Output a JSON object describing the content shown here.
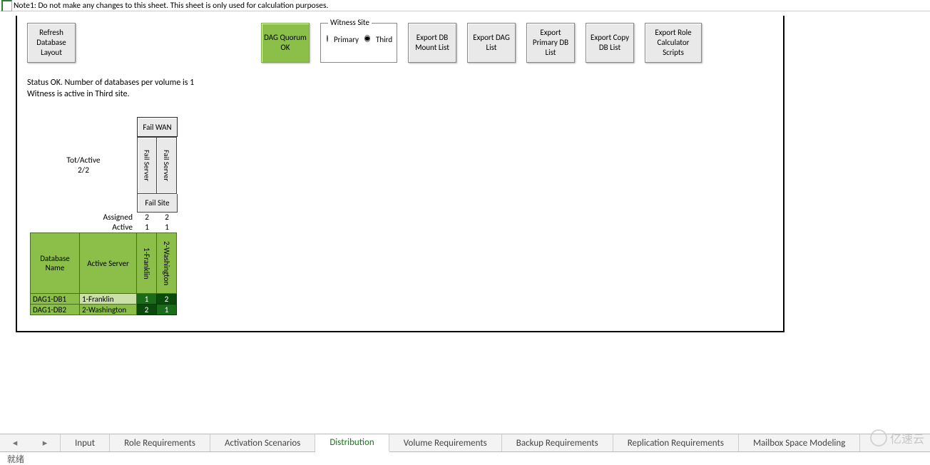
{
  "note": "Note1: Do not make any changes to this sheet.  This sheet is only used for calculation purposes.",
  "toolbar": {
    "refresh": "Refresh Database Layout",
    "dag_quorum": "DAG Quorum OK",
    "witness_legend": "Witness Site",
    "witness_primary": "Primary",
    "witness_third": "Third",
    "witness_selected": "Third",
    "export_mount": "Export DB Mount List",
    "export_dag": "Export DAG List",
    "export_primary": "Export Primary DB List",
    "export_copy": "Export Copy DB List",
    "export_role": "Export Role Calculator Scripts"
  },
  "status": {
    "line1": "Status OK.  Number of databases per volume is 1",
    "line2": "Witness is active in Third site."
  },
  "fail": {
    "wan": "Fail WAN",
    "server": "Fail Server",
    "site": "Fail Site",
    "tot_label": "Tot/Active",
    "tot_value": "2/2",
    "assigned_label": "Assigned",
    "active_label": "Active",
    "assigned": [
      "2",
      "2"
    ],
    "active": [
      "1",
      "1"
    ]
  },
  "headers": {
    "db_name": "Database Name",
    "active_server": "Active Server",
    "cols": [
      "1-Franklin",
      "2-Washington"
    ]
  },
  "rows": [
    {
      "db": "DAG1-DB1",
      "server": "1-Franklin",
      "v": [
        "1",
        "2"
      ],
      "cls": [
        "g1",
        "g2"
      ]
    },
    {
      "db": "DAG1-DB2",
      "server": "2-Washington",
      "v": [
        "2",
        "1"
      ],
      "cls": [
        "g2",
        "g1"
      ]
    }
  ],
  "tabs": {
    "list": [
      "Input",
      "Role Requirements",
      "Activation Scenarios",
      "Distribution",
      "Volume Requirements",
      "Backup Requirements",
      "Replication Requirements",
      "Mailbox Space Modeling"
    ],
    "active": "Distribution"
  },
  "statusbar": "就绪",
  "watermark": "亿速云"
}
